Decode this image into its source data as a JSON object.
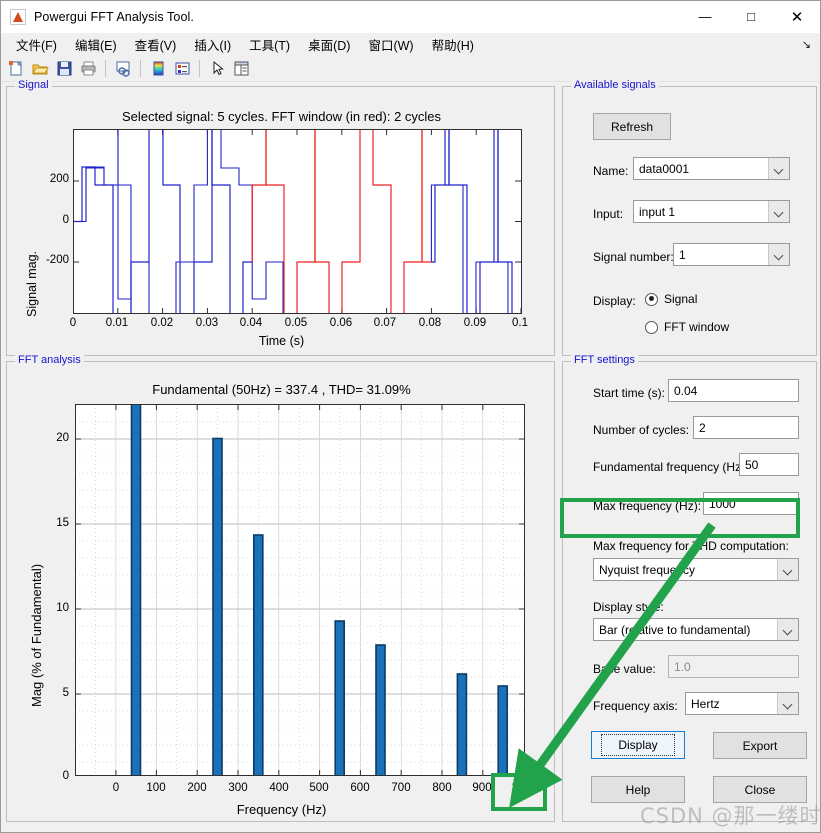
{
  "window": {
    "title": "Powergui FFT Analysis Tool.",
    "app_icon": "matlab-icon",
    "minimize": "—",
    "maximize": "□",
    "close": "✕"
  },
  "menubar": {
    "items": [
      {
        "label": "文件(F)",
        "name": "menu-file"
      },
      {
        "label": "编辑(E)",
        "name": "menu-edit"
      },
      {
        "label": "查看(V)",
        "name": "menu-view"
      },
      {
        "label": "插入(I)",
        "name": "menu-insert"
      },
      {
        "label": "工具(T)",
        "name": "menu-tools"
      },
      {
        "label": "桌面(D)",
        "name": "menu-desktop"
      },
      {
        "label": "窗口(W)",
        "name": "menu-window"
      },
      {
        "label": "帮助(H)",
        "name": "menu-help"
      }
    ],
    "overflow": "↘"
  },
  "toolbar": {
    "buttons": [
      {
        "name": "new-figure-icon",
        "glyph": "new"
      },
      {
        "name": "open-file-icon",
        "glyph": "open"
      },
      {
        "name": "save-icon",
        "glyph": "save"
      },
      {
        "name": "print-icon",
        "glyph": "print"
      },
      {
        "name": "link-plot-icon",
        "glyph": "link"
      },
      {
        "name": "colorbar-icon",
        "glyph": "colorbar"
      },
      {
        "name": "legend-icon",
        "glyph": "legend"
      },
      {
        "name": "pointer-icon",
        "glyph": "pointer"
      },
      {
        "name": "plot-browser-icon",
        "glyph": "browser"
      }
    ]
  },
  "signal_panel": {
    "legend": "Signal",
    "chart_data": {
      "type": "line",
      "title": "Selected signal: 5 cycles. FFT window (in red): 2 cycles",
      "xlabel": "Time (s)",
      "ylabel": "Signal mag.",
      "xlim": [
        0,
        0.1
      ],
      "ylim": [
        -360,
        360
      ],
      "xticks": [
        "0",
        "0.01",
        "0.02",
        "0.03",
        "0.04",
        "0.05",
        "0.06",
        "0.07",
        "0.08",
        "0.09",
        "0.1"
      ],
      "yticks": [
        "200",
        "0",
        "-200"
      ],
      "grid": false,
      "series": [
        {
          "name": "signal",
          "color": "#2222cc",
          "note": "staircase multilevel inverter waveform, 5 cycles over 0-0.1 s"
        },
        {
          "name": "fft-window",
          "color": "#ee2222",
          "note": "red highlighted FFT window from 0.04 s to 0.08 s (2 cycles)"
        }
      ],
      "levels": [
        0,
        262,
        178,
        -178,
        -350,
        350
      ],
      "window_start_s": 0.04,
      "window_end_s": 0.08
    }
  },
  "available_signals": {
    "legend": "Available signals",
    "refresh_label": "Refresh",
    "name_label": "Name:",
    "name_value": "data0001",
    "input_label": "Input:",
    "input_value": "input 1",
    "signal_number_label": "Signal number:",
    "signal_number_value": "1",
    "display_label": "Display:",
    "radio_signal": "Signal",
    "radio_fft_window": "FFT window",
    "radio_selected": "Signal"
  },
  "fft_analysis": {
    "legend": "FFT analysis",
    "chart_data": {
      "type": "bar",
      "title": "Fundamental (50Hz) = 337.4 , THD= 31.09%",
      "xlabel": "Frequency (Hz)",
      "ylabel": "Mag (% of Fundamental)",
      "xlim": [
        -50,
        1050
      ],
      "ylim": [
        0,
        22.2
      ],
      "xticks": [
        "0",
        "100",
        "200",
        "300",
        "400",
        "500",
        "600",
        "700",
        "800",
        "900",
        "1000"
      ],
      "yticks": [
        "0",
        "5",
        "10",
        "15",
        "20"
      ],
      "grid": true,
      "bar_color": "#1b72b8",
      "bar_edge_color": "#0a3c66",
      "categories": [
        50,
        250,
        350,
        550,
        650,
        850,
        950
      ],
      "values": [
        100,
        20.0,
        14.3,
        9.1,
        7.7,
        6.0,
        5.3
      ],
      "note": "fundamental bar at 50 Hz is clipped at the top of the axis"
    }
  },
  "fft_settings": {
    "legend": "FFT settings",
    "start_time_label": "Start time (s):",
    "start_time_value": "0.04",
    "num_cycles_label": "Number of cycles:",
    "num_cycles_value": "2",
    "fundamental_freq_label": "Fundamental frequency (Hz):",
    "fundamental_freq_value": "50",
    "max_freq_label": "Max frequency (Hz):",
    "max_freq_value": "1000",
    "max_freq_thd_label": "Max frequency for THD computation:",
    "max_freq_thd_value": "Nyquist frequency",
    "display_style_label": "Display style:",
    "display_style_value": "Bar (relative to fundamental)",
    "base_value_label": "Base value:",
    "base_value_value": "1.0",
    "frequency_axis_label": "Frequency axis:",
    "frequency_axis_value": "Hertz",
    "display_button": "Display",
    "export_button": "Export",
    "help_button": "Help",
    "close_button": "Close"
  },
  "annotations": {
    "highlight_color": "#22a24a",
    "highlighted_field": "Max frequency (Hz): 1000",
    "highlighted_tick": "1000",
    "arrow": "green-arrow-from-max-frequency-field-to-x-axis-1000-tick"
  },
  "watermark": "CSDN @那一缕时光"
}
